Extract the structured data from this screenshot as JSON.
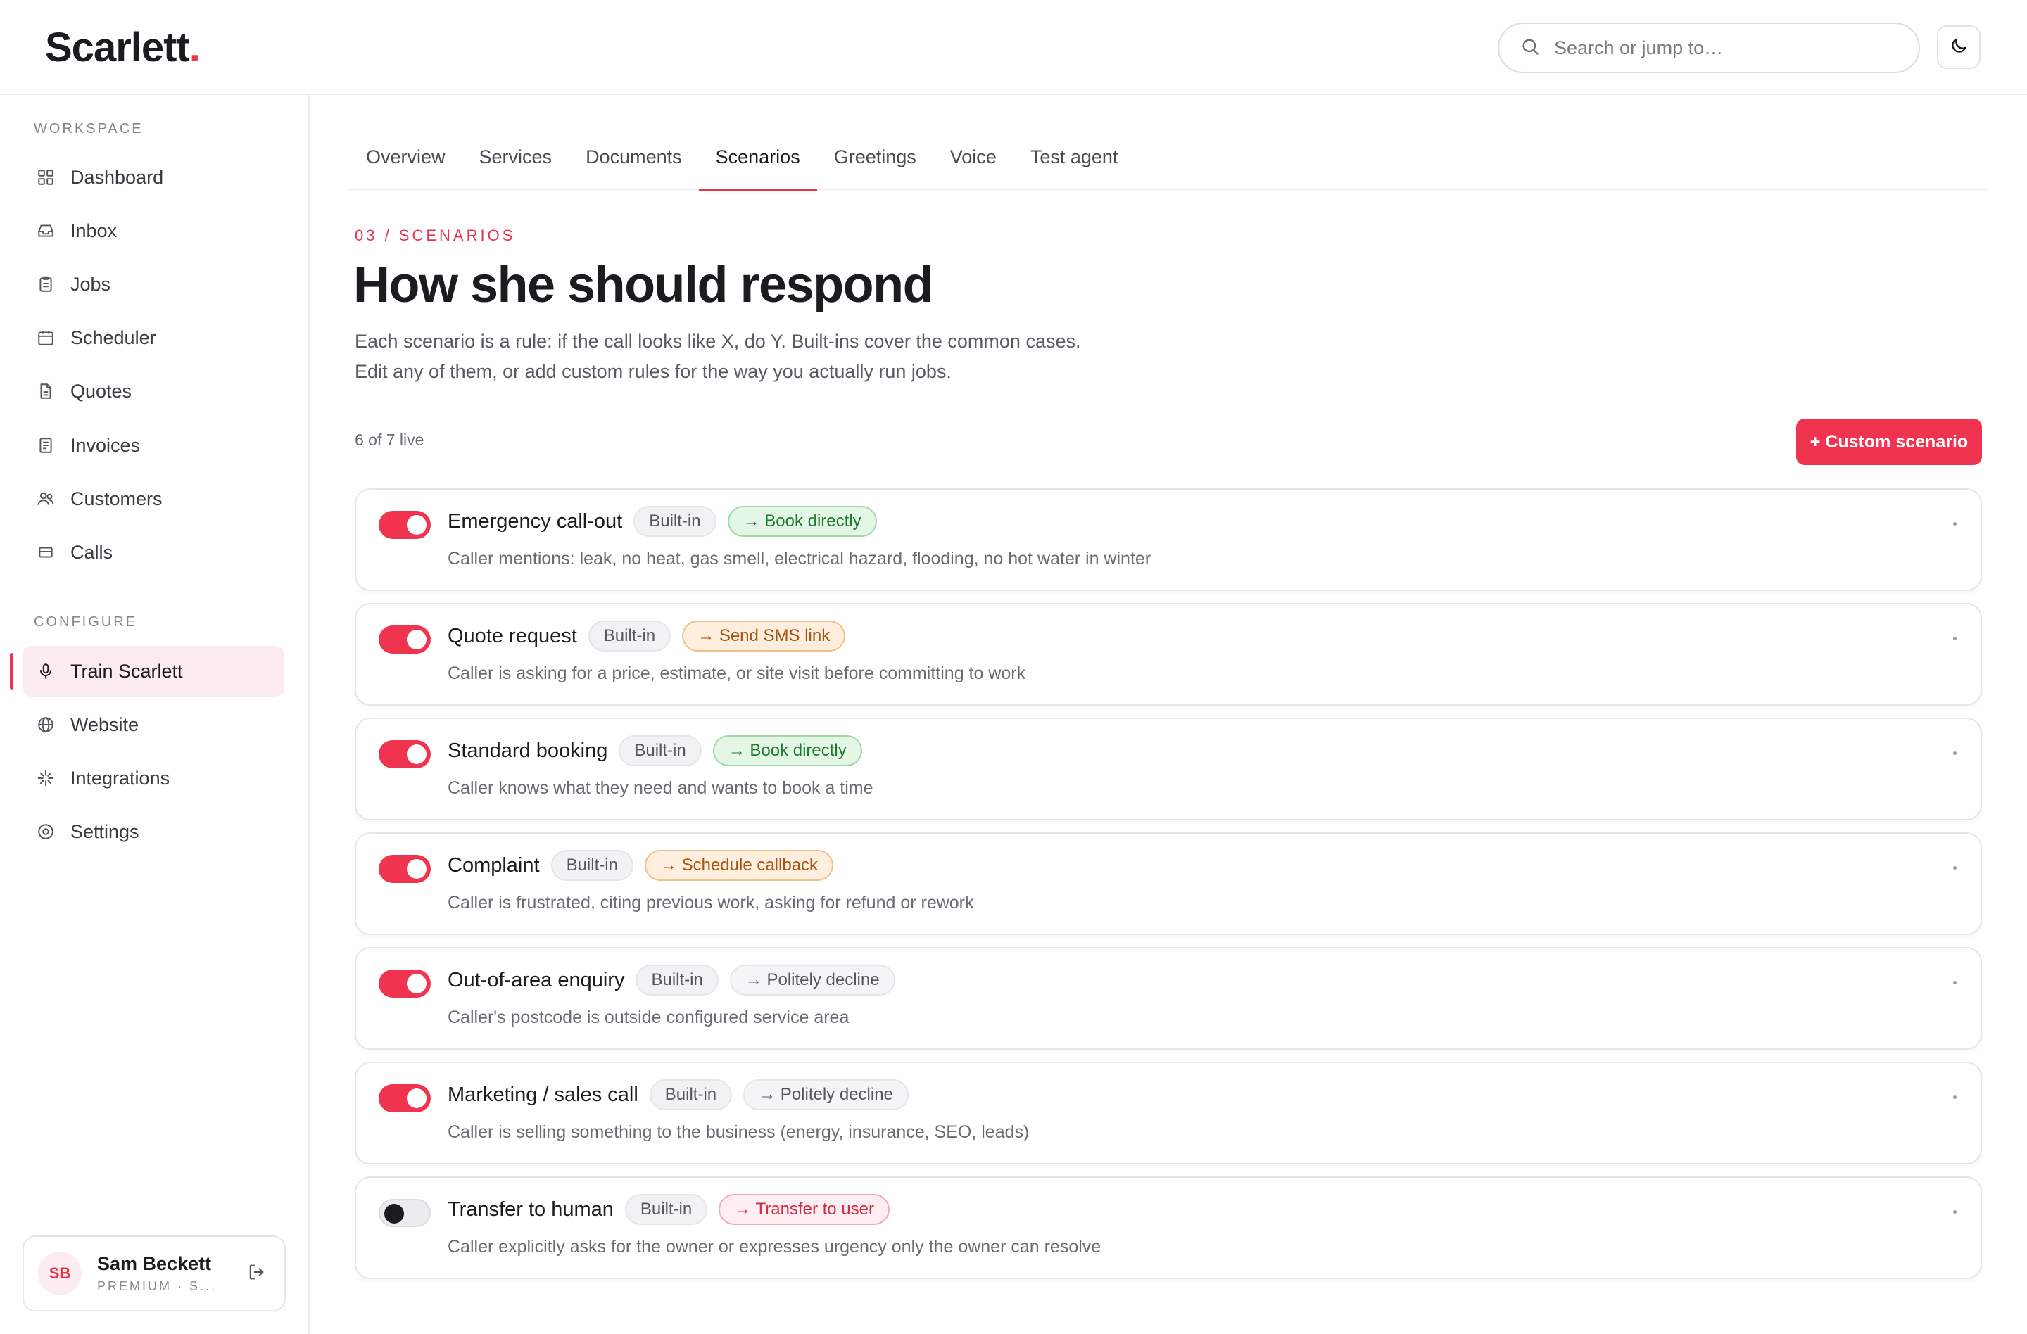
{
  "app": {
    "logo_text": "Scarlett",
    "logo_dot": ".",
    "accent_color": "#f0334f"
  },
  "search": {
    "placeholder": "Search or jump to…",
    "icon": "search-icon"
  },
  "theme_toggle": {
    "icon": "moon-icon"
  },
  "sidebar": {
    "workspace_label": "WORKSPACE",
    "configure_label": "CONFIGURE",
    "workspace_items": [
      {
        "label": "Dashboard",
        "icon": "grid-icon"
      },
      {
        "label": "Inbox",
        "icon": "inbox-icon"
      },
      {
        "label": "Jobs",
        "icon": "clipboard-icon"
      },
      {
        "label": "Scheduler",
        "icon": "calendar-icon"
      },
      {
        "label": "Quotes",
        "icon": "document-icon"
      },
      {
        "label": "Invoices",
        "icon": "receipt-icon"
      },
      {
        "label": "Customers",
        "icon": "users-icon"
      },
      {
        "label": "Calls",
        "icon": "phone-log-icon"
      }
    ],
    "configure_items": [
      {
        "label": "Train Scarlett",
        "icon": "microphone-icon",
        "active": true
      },
      {
        "label": "Website",
        "icon": "globe-icon"
      },
      {
        "label": "Integrations",
        "icon": "sparkle-icon"
      },
      {
        "label": "Settings",
        "icon": "settings-icon"
      }
    ]
  },
  "user": {
    "initials": "SB",
    "name": "Sam Beckett",
    "plan": "PREMIUM · S..."
  },
  "tabs": [
    {
      "label": "Overview"
    },
    {
      "label": "Services"
    },
    {
      "label": "Documents"
    },
    {
      "label": "Scenarios",
      "active": true
    },
    {
      "label": "Greetings"
    },
    {
      "label": "Voice"
    },
    {
      "label": "Test agent"
    }
  ],
  "page": {
    "eyebrow": "03 / SCENARIOS",
    "title": "How she should respond",
    "description": "Each scenario is a rule: if the call looks like X, do Y. Built-ins cover the common cases. Edit any of them, or add custom rules for the way you actually run jobs.",
    "live_count": "6 of 7 live",
    "add_button": "+ Custom scenario"
  },
  "scenarios": [
    {
      "title": "Emergency call-out",
      "tag": "Built-in",
      "action": "→ Book directly",
      "action_style": "green",
      "description": "Caller mentions: leak, no heat, gas smell, electrical hazard, flooding, no hot water in winter",
      "enabled": true
    },
    {
      "title": "Quote request",
      "tag": "Built-in",
      "action": "→ Send SMS link",
      "action_style": "orange",
      "description": "Caller is asking for a price, estimate, or site visit before committing to work",
      "enabled": true
    },
    {
      "title": "Standard booking",
      "tag": "Built-in",
      "action": "→ Book directly",
      "action_style": "green",
      "description": "Caller knows what they need and wants to book a time",
      "enabled": true
    },
    {
      "title": "Complaint",
      "tag": "Built-in",
      "action": "→ Schedule callback",
      "action_style": "orange",
      "description": "Caller is frustrated, citing previous work, asking for refund or rework",
      "enabled": true
    },
    {
      "title": "Out-of-area enquiry",
      "tag": "Built-in",
      "action": "→ Politely decline",
      "action_style": "grey",
      "description": "Caller's postcode is outside configured service area",
      "enabled": true
    },
    {
      "title": "Marketing / sales call",
      "tag": "Built-in",
      "action": "→ Politely decline",
      "action_style": "grey",
      "description": "Caller is selling something to the business (energy, insurance, SEO, leads)",
      "enabled": true
    },
    {
      "title": "Transfer to human",
      "tag": "Built-in",
      "action": "→ Transfer to user",
      "action_style": "pink",
      "description": "Caller explicitly asks for the owner or expresses urgency only the owner can resolve",
      "enabled": false
    }
  ]
}
